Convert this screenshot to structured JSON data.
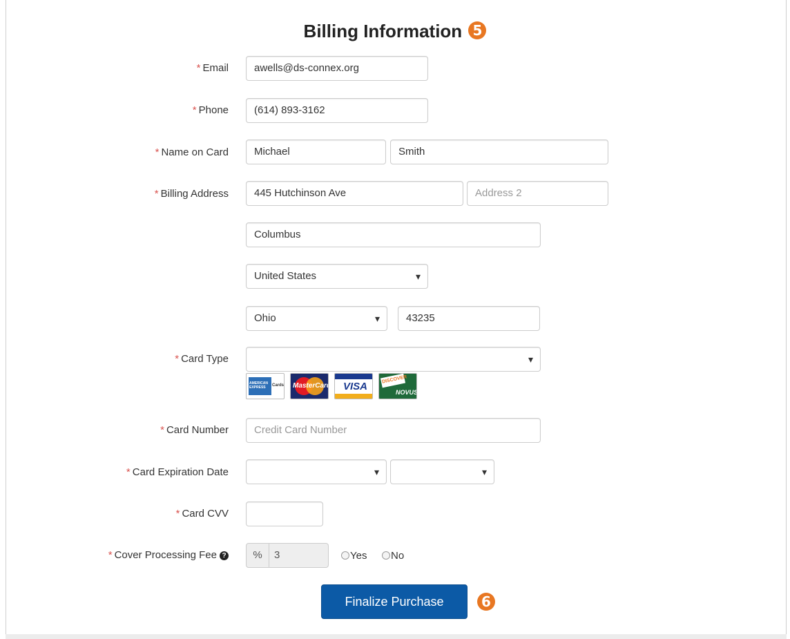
{
  "form": {
    "title": "Billing Information",
    "step_badge": "5",
    "required_marker": "*",
    "email": {
      "label": "Email",
      "value": "awells@ds-connex.org"
    },
    "phone": {
      "label": "Phone",
      "value": "(614) 893-3162"
    },
    "name_on_card": {
      "label": "Name on Card",
      "first": "Michael",
      "last": "Smith"
    },
    "billing_address": {
      "label": "Billing Address",
      "address1": "445 Hutchinson Ave",
      "address2_placeholder": "Address 2",
      "city": "Columbus",
      "country": "United States",
      "state": "Ohio",
      "zip": "43235"
    },
    "card_type": {
      "label": "Card Type",
      "selected": "",
      "logos": [
        {
          "icon": "american-express-card-icon",
          "text": "AMERICAN EXPRESS",
          "extra": "Cards"
        },
        {
          "icon": "mastercard-card-icon",
          "text": "MasterCard"
        },
        {
          "icon": "visa-card-icon",
          "text": "VISA"
        },
        {
          "icon": "discover-novus-card-icon",
          "text": "DISCOVER",
          "extra": "NOVUS"
        }
      ]
    },
    "card_number": {
      "label": "Card Number",
      "placeholder": "Credit Card Number"
    },
    "card_expiration": {
      "label": "Card Expiration Date",
      "month": "",
      "year": ""
    },
    "card_cvv": {
      "label": "Card CVV",
      "value": ""
    },
    "processing_fee": {
      "label": "Cover Processing Fee",
      "help_icon": "?",
      "addon": "%",
      "value": "3",
      "options": [
        "Yes",
        "No"
      ]
    },
    "submit": {
      "label": "Finalize Purchase",
      "step_badge": "6"
    }
  },
  "colors": {
    "accent": "#e87722",
    "button": "#0c5aa6",
    "required": "#d9534f"
  }
}
